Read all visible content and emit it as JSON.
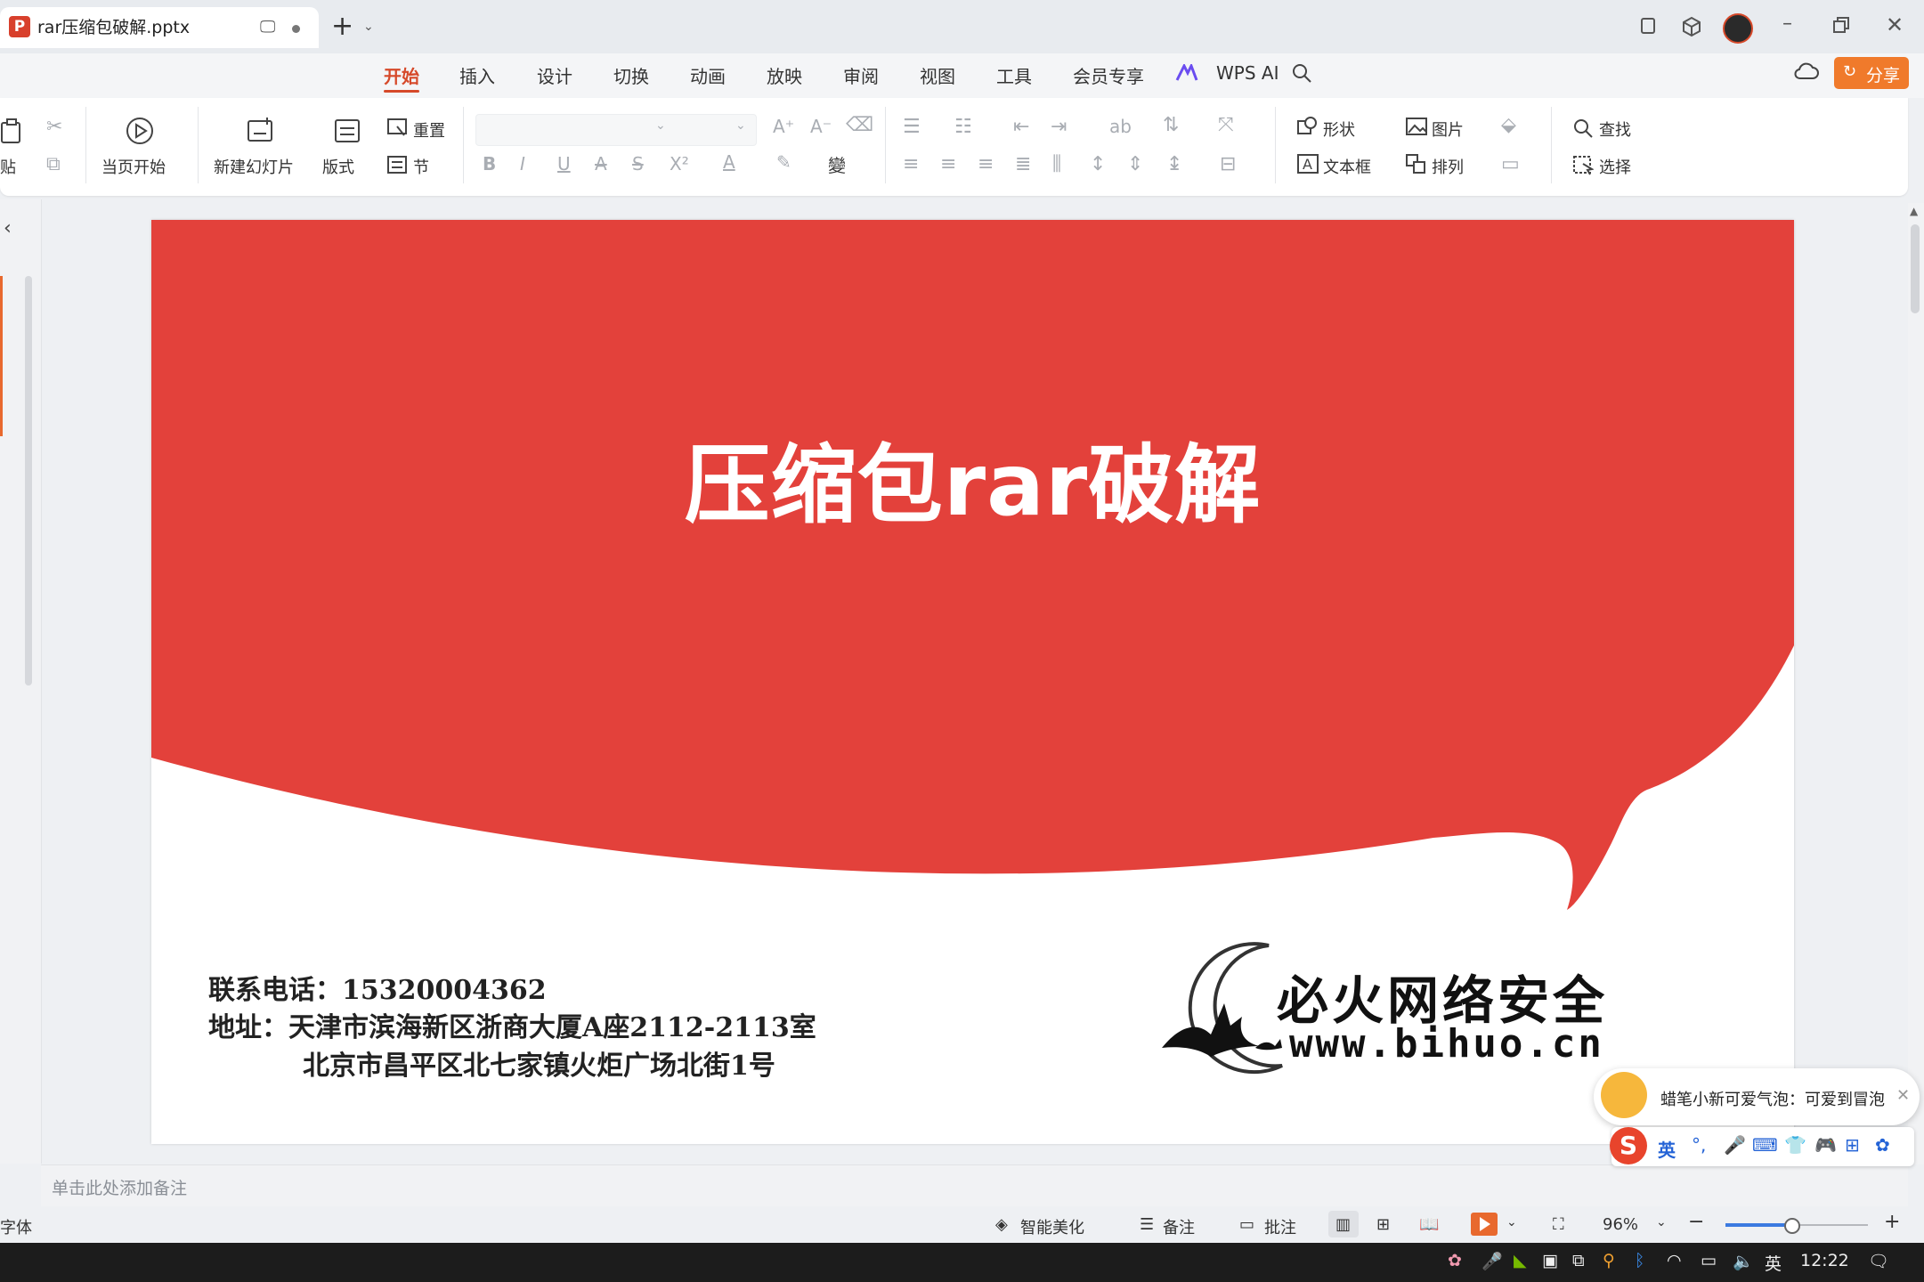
{
  "window": {
    "tab_title": "rar压缩包破解.pptx",
    "new_tab": "+"
  },
  "menu": {
    "items": [
      "开始",
      "插入",
      "设计",
      "切换",
      "动画",
      "放映",
      "审阅",
      "视图",
      "工具",
      "会员专享"
    ],
    "active": "开始",
    "wps_ai": "WPS AI",
    "share": "分享"
  },
  "ribbon": {
    "paste": "贴",
    "from_current": "当页开始",
    "new_slide": "新建幻灯片",
    "layout": "版式",
    "reset": "重置",
    "section": "节",
    "shape": "形状",
    "picture": "图片",
    "textbox": "文本框",
    "arrange": "排列",
    "find": "查找",
    "select": "选择"
  },
  "slide": {
    "title": "压缩包rar破解",
    "phone_line": "联系电话：15320004362",
    "address_line1": "地址：天津市滨海新区浙商大厦A座2112-2113室",
    "address_line2": "北京市昌平区北七家镇火炬广场北街1号",
    "brand_name": "必火网络安全",
    "brand_url": "www.bihuo.cn"
  },
  "notes": {
    "placeholder": "单击此处添加备注"
  },
  "status": {
    "left": "字体",
    "beautify": "智能美化",
    "notes": "备注",
    "comment": "批注",
    "zoom": "96%"
  },
  "popup": {
    "message": "蜡笔小新可爱气泡：可爱到冒泡",
    "ime_lang": "英"
  },
  "taskbar": {
    "lang": "英",
    "time": "12:22"
  },
  "colors": {
    "accent": "#d6492a",
    "slide_red": "#e3413b",
    "share_btn": "#f07a2b"
  }
}
